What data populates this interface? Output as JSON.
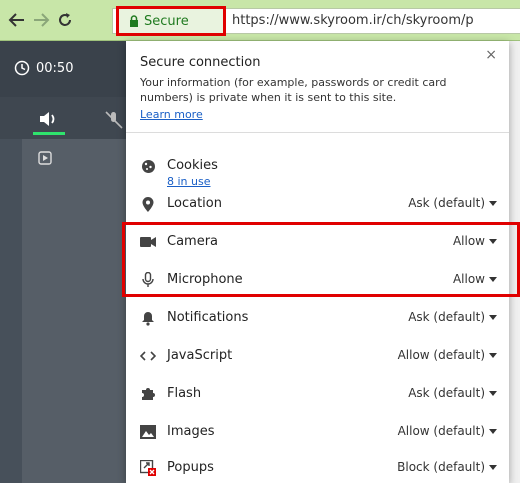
{
  "browser": {
    "secure_label": "Secure",
    "url": "https://www.skyroom.ir/ch/skyroom/p"
  },
  "app": {
    "timer": "00:50"
  },
  "popup": {
    "title": "Secure connection",
    "description": "Your information (for example, passwords or credit card numbers) is private when it is sent to this site.",
    "learn_more": "Learn more",
    "close": "×",
    "cookies": {
      "label": "Cookies",
      "sub": "8 in use"
    },
    "permissions": [
      {
        "label": "Location",
        "value": "Ask (default)",
        "icon": "location-pin-icon"
      },
      {
        "label": "Camera",
        "value": "Allow",
        "icon": "camera-icon"
      },
      {
        "label": "Microphone",
        "value": "Allow",
        "icon": "microphone-icon"
      },
      {
        "label": "Notifications",
        "value": "Ask (default)",
        "icon": "bell-icon"
      },
      {
        "label": "JavaScript",
        "value": "Allow (default)",
        "icon": "code-icon"
      },
      {
        "label": "Flash",
        "value": "Ask (default)",
        "icon": "puzzle-icon"
      },
      {
        "label": "Images",
        "value": "Allow (default)",
        "icon": "image-icon"
      },
      {
        "label": "Popups",
        "value": "Block (default)",
        "icon": "popup-blocked-icon"
      }
    ]
  },
  "colors": {
    "toolbar_bg": "#c8e6a8",
    "highlight": "#e00000",
    "secure_green": "#1f7a1f",
    "link": "#1a5fc6",
    "app_dark": "#47505a",
    "active_tab": "#2fe36d"
  }
}
